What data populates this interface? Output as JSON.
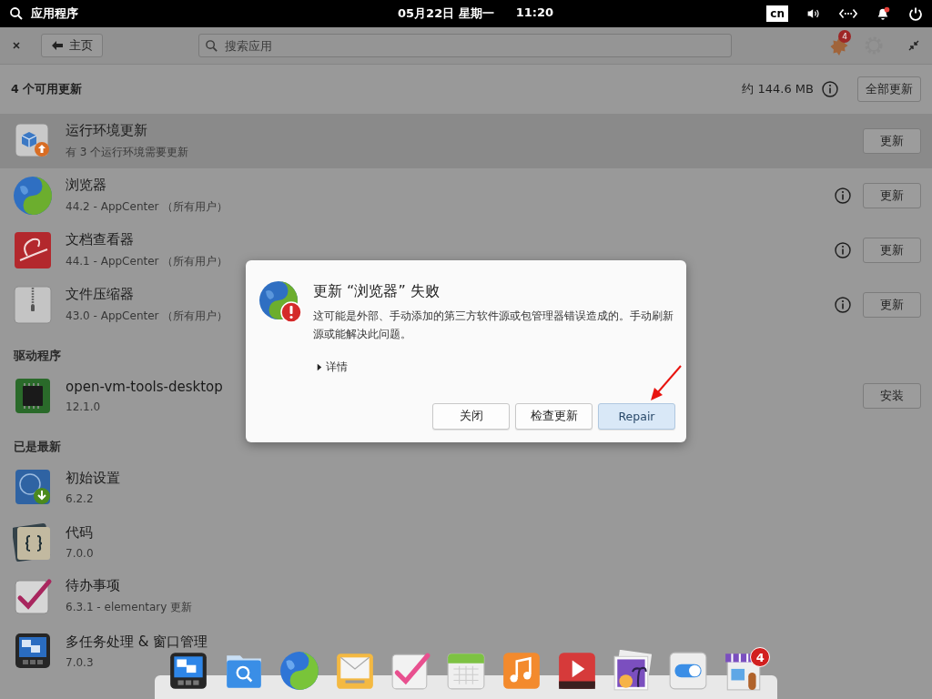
{
  "panel": {
    "app_menu": "应用程序",
    "date": "05月22日 星期一",
    "time": "11:20",
    "keyboard_layout": "cn",
    "notifications_unread": true
  },
  "header": {
    "home_button": "主页",
    "search_placeholder": "搜索应用",
    "updates_badge": "4"
  },
  "updates_bar": {
    "title": "4 个可用更新",
    "size": "约 144.6 MB",
    "button": "全部更新"
  },
  "list": [
    {
      "kind": "app",
      "name": "运行环境更新",
      "detail": "有 3 个运行环境需要更新",
      "selected": true,
      "info": false,
      "action": "更新"
    },
    {
      "kind": "app",
      "name": "浏览器",
      "detail": "44.2 - AppCenter （所有用户）",
      "selected": false,
      "info": true,
      "action": "更新"
    },
    {
      "kind": "app",
      "name": "文档查看器",
      "detail": "44.1 - AppCenter （所有用户）",
      "selected": false,
      "info": true,
      "action": "更新"
    },
    {
      "kind": "app",
      "name": "文件压缩器",
      "detail": "43.0 - AppCenter （所有用户）",
      "selected": false,
      "info": true,
      "action": "更新"
    },
    {
      "kind": "section",
      "label": "驱动程序"
    },
    {
      "kind": "app",
      "name": "open-vm-tools-desktop",
      "detail": "12.1.0",
      "selected": false,
      "info": false,
      "action": "安装"
    },
    {
      "kind": "section",
      "label": "已是最新"
    },
    {
      "kind": "app",
      "name": "初始设置",
      "detail": "6.2.2",
      "selected": false,
      "info": false
    },
    {
      "kind": "app",
      "name": "代码",
      "detail": "7.0.0",
      "selected": false,
      "info": false
    },
    {
      "kind": "app",
      "name": "待办事项",
      "detail": "6.3.1 - elementary 更新",
      "selected": false,
      "info": false
    },
    {
      "kind": "app",
      "name": "多任务处理 & 窗口管理",
      "detail": "7.0.3",
      "selected": false,
      "info": false
    }
  ],
  "dialog": {
    "title": "更新 “浏览器” 失败",
    "message": "这可能是外部、手动添加的第三方软件源或包管理器错误造成的。手动刷新源或能解决此问题。",
    "details": "详情",
    "buttons": [
      {
        "label": "关闭",
        "suggested": false
      },
      {
        "label": "检查更新",
        "suggested": false
      },
      {
        "label": "Repair",
        "suggested": true
      }
    ]
  },
  "dock": {
    "store_badge": "4"
  }
}
